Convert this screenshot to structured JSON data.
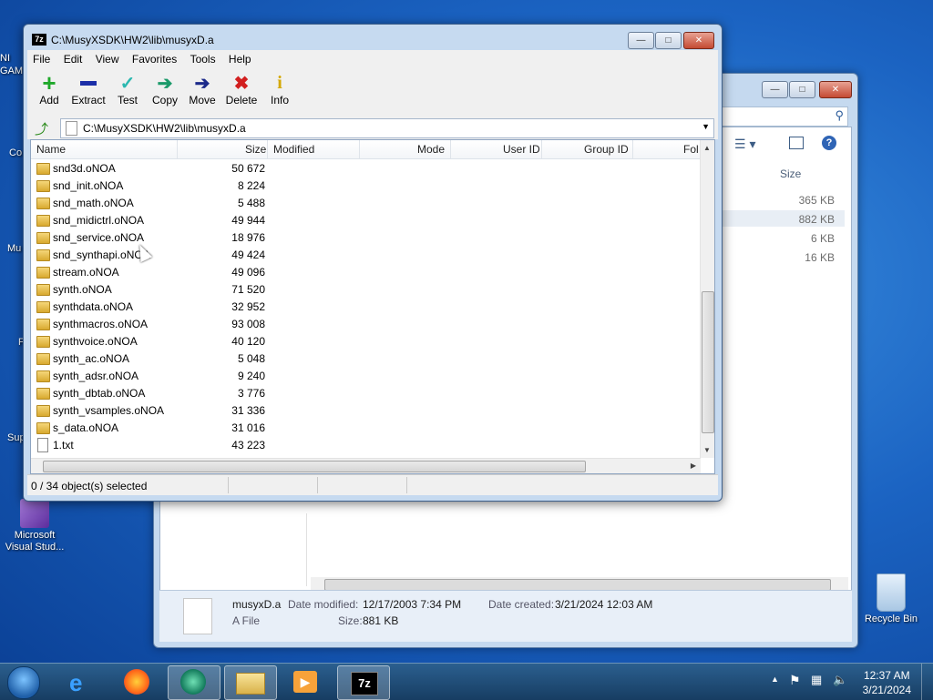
{
  "desktop": {
    "icons": [
      {
        "label": "Microsoft Visual Stud..."
      },
      {
        "label": "Recycle Bin"
      }
    ],
    "clipped_labels": [
      "NI",
      "GAM",
      "Co",
      "Mu",
      "F",
      "Sup"
    ]
  },
  "explorer": {
    "size_header": "Size",
    "sizes": [
      "365 KB",
      "882 KB",
      "6 KB",
      "16 KB"
    ],
    "details": {
      "file_name": "musyxD.a",
      "file_type": "A File",
      "date_modified_label": "Date modified:",
      "date_modified": "12/17/2003 7:34 PM",
      "date_created_label": "Date created:",
      "date_created": "3/21/2024 12:03 AM",
      "size_label": "Size:",
      "size": "881 KB"
    }
  },
  "zip": {
    "title": "C:\\MusyXSDK\\HW2\\lib\\musyxD.a",
    "logo": "7z",
    "menu": [
      "File",
      "Edit",
      "View",
      "Favorites",
      "Tools",
      "Help"
    ],
    "toolbar": [
      "Add",
      "Extract",
      "Test",
      "Copy",
      "Move",
      "Delete",
      "Info"
    ],
    "address": "C:\\MusyXSDK\\HW2\\lib\\musyxD.a",
    "columns": [
      "Name",
      "Size",
      "Modified",
      "Mode",
      "User ID",
      "Group ID",
      "Fol"
    ],
    "rows": [
      {
        "name": "snd3d.oNOA",
        "size": "50 672",
        "type": "folder"
      },
      {
        "name": "snd_init.oNOA",
        "size": "8 224",
        "type": "folder"
      },
      {
        "name": "snd_math.oNOA",
        "size": "5 488",
        "type": "folder"
      },
      {
        "name": "snd_midictrl.oNOA",
        "size": "49 944",
        "type": "folder"
      },
      {
        "name": "snd_service.oNOA",
        "size": "18 976",
        "type": "folder"
      },
      {
        "name": "snd_synthapi.oNOA",
        "size": "49 424",
        "type": "folder"
      },
      {
        "name": "stream.oNOA",
        "size": "49 096",
        "type": "folder"
      },
      {
        "name": "synth.oNOA",
        "size": "71 520",
        "type": "folder"
      },
      {
        "name": "synthdata.oNOA",
        "size": "32 952",
        "type": "folder"
      },
      {
        "name": "synthmacros.oNOA",
        "size": "93 008",
        "type": "folder"
      },
      {
        "name": "synthvoice.oNOA",
        "size": "40 120",
        "type": "folder"
      },
      {
        "name": "synth_ac.oNOA",
        "size": "5 048",
        "type": "folder"
      },
      {
        "name": "synth_adsr.oNOA",
        "size": "9 240",
        "type": "folder"
      },
      {
        "name": "synth_dbtab.oNOA",
        "size": "3 776",
        "type": "folder"
      },
      {
        "name": "synth_vsamples.oNOA",
        "size": "31 336",
        "type": "folder"
      },
      {
        "name": "s_data.oNOA",
        "size": "31 016",
        "type": "folder"
      },
      {
        "name": "1.txt",
        "size": "43 223",
        "type": "file"
      }
    ],
    "status": "0 / 34 object(s) selected"
  },
  "taskbar": {
    "time": "12:37 AM",
    "date": "3/21/2024",
    "z7_label": "7z"
  },
  "colors": {
    "add": "#1fa82a",
    "extract": "#1c2fa8",
    "test": "#2bb8b0",
    "copy": "#1b9a6a",
    "move": "#1c2a8a",
    "delete": "#d21f1f",
    "info": "#d4a800"
  }
}
